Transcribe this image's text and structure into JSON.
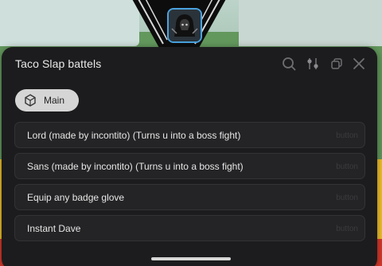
{
  "window": {
    "title": "Taco Slap battels"
  },
  "toolbar": {
    "icons": [
      "search-icon",
      "settings-sliders-icon",
      "minimize-window-icon",
      "close-icon"
    ]
  },
  "tabs": [
    {
      "label": "Main",
      "icon": "cube-icon",
      "selected": true
    }
  ],
  "items": [
    {
      "label": "Lord (made by incontito) (Turns u into a boss fight)",
      "type": "button"
    },
    {
      "label": "Sans (made by incontito) (Turns u into a boss fight)",
      "type": "button"
    },
    {
      "label": "Equip any badge glove",
      "type": "button"
    },
    {
      "label": "Instant Dave",
      "type": "button"
    }
  ],
  "colors": {
    "window_bg": "#1c1c1e",
    "item_bg": "#242426",
    "tab_bg": "#d5d5d5",
    "avatar_border": "#4aa3e0"
  }
}
